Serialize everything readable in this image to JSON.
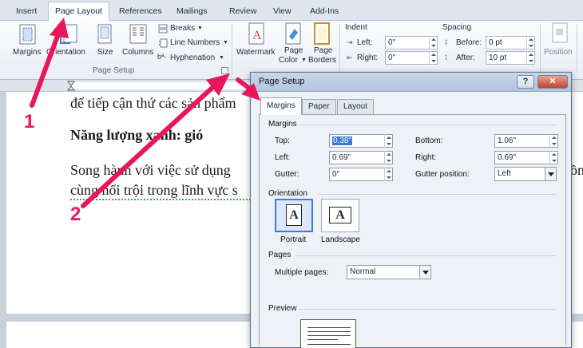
{
  "tabs": [
    "Insert",
    "Page Layout",
    "References",
    "Mailings",
    "Review",
    "View",
    "Add-Ins"
  ],
  "ribbon": {
    "page_setup": {
      "margins": "Margins",
      "orientation": "Orientation",
      "size": "Size",
      "columns": "Columns",
      "breaks": "Breaks",
      "line_numbers": "Line Numbers",
      "hyphenation": "Hyphenation",
      "group_title": "Page Setup"
    },
    "page_background": {
      "watermark": "Watermark",
      "page_color_1": "Page",
      "page_color_2": "Color",
      "page_borders_1": "Page",
      "page_borders_2": "Borders"
    },
    "indent": {
      "title": "Indent",
      "left_label": "Left:",
      "left_value": "0\"",
      "right_label": "Right:",
      "right_value": "0\""
    },
    "spacing": {
      "title": "Spacing",
      "before_label": "Before:",
      "before_value": "0 pt",
      "after_label": "After:",
      "after_value": "10 pt"
    },
    "arrange": {
      "position": "Position"
    }
  },
  "document": {
    "line1": "để tiếp cận thứ các sản phẩm",
    "heading": "Năng lượng xanh: gió",
    "line3": "Song hành với việc sử dụng",
    "line4": "cùng nổi trội trong lĩnh vực s",
    "line3_tail": "ồn"
  },
  "dialog": {
    "title": "Page Setup",
    "help": "?",
    "close": "✕",
    "tabs": [
      "Margins",
      "Paper",
      "Layout"
    ],
    "margins_section": "Margins",
    "top_label": "Top:",
    "top_value": "0.38\"",
    "bottom_label": "Bottom:",
    "bottom_value": "1.06\"",
    "left_label": "Left:",
    "left_value": "0.69\"",
    "right_label": "Right:",
    "right_value": "0.69\"",
    "gutter_label": "Gutter:",
    "gutter_value": "0\"",
    "gutter_pos_label": "Gutter position:",
    "gutter_pos_value": "Left",
    "orientation_section": "Orientation",
    "portrait": "Portrait",
    "landscape": "Landscape",
    "pages_section": "Pages",
    "multiple_pages_label": "Multiple pages:",
    "multiple_pages_value": "Normal",
    "preview_section": "Preview",
    "orient_glyph": "A"
  },
  "annotations": {
    "one": "1",
    "two": "2"
  },
  "colors": {
    "arrow": "#e8175c",
    "selection": "#3b78d8"
  }
}
